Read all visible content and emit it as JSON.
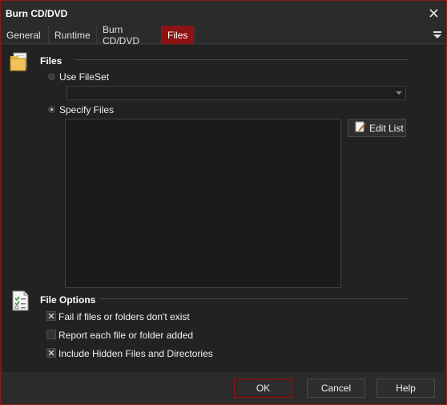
{
  "window": {
    "title": "Burn CD/DVD",
    "close_icon": "close-icon"
  },
  "tabs": [
    {
      "label": "General",
      "active": false
    },
    {
      "label": "Runtime",
      "active": false
    },
    {
      "label": "Burn CD/DVD",
      "active": false
    },
    {
      "label": "Files",
      "active": true
    }
  ],
  "files_section": {
    "title": "Files",
    "use_fileset_label": "Use FileSet",
    "use_fileset_selected": false,
    "fileset_value": "",
    "specify_files_label": "Specify Files",
    "specify_files_selected": true,
    "files": [],
    "edit_list_label": "Edit List"
  },
  "file_options": {
    "title": "File Options",
    "options": [
      {
        "label": "Fail if files or folders don't exist",
        "checked": true
      },
      {
        "label": "Report each file or folder added",
        "checked": false
      },
      {
        "label": "Include Hidden Files and Directories",
        "checked": true
      }
    ]
  },
  "footer": {
    "ok_label": "OK",
    "cancel_label": "Cancel",
    "help_label": "Help"
  },
  "colors": {
    "accent": "#8e1212",
    "background": "#2b2b2b",
    "panel": "#222222"
  }
}
